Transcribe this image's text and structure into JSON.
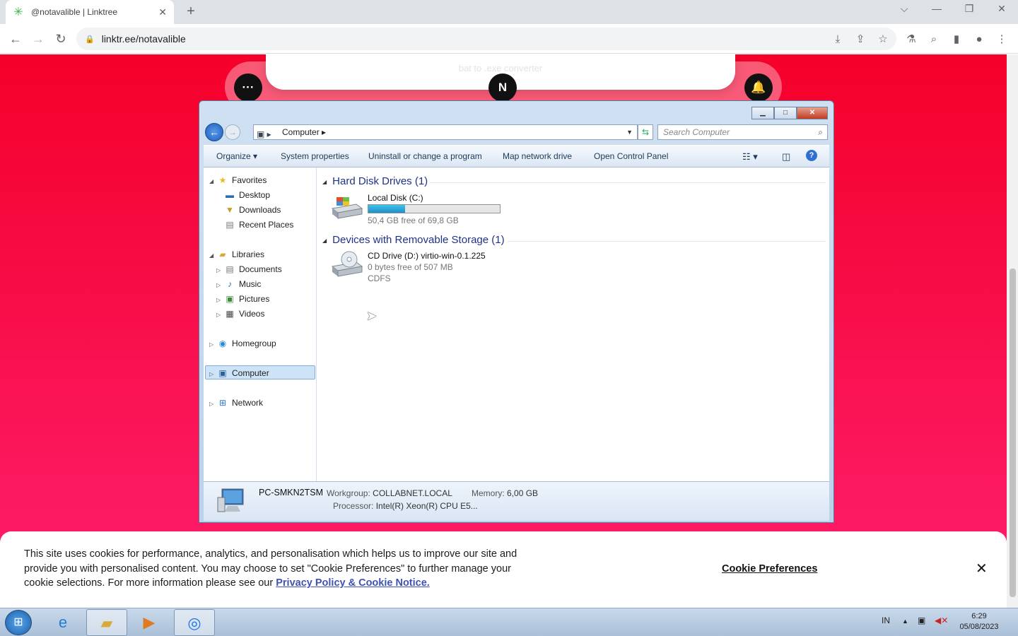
{
  "browser": {
    "tab_title": "@notavalible | Linktree",
    "url": "linktr.ee/notavalible",
    "tab_close": "✕",
    "new_tab": "+"
  },
  "linktree": {
    "search_text": "bat to .exe converter",
    "menu_label": "···",
    "avatar_letter": "N"
  },
  "explorer": {
    "breadcrumb": "Computer",
    "search_placeholder": "Search Computer",
    "commands": [
      "Organize",
      "System properties",
      "Uninstall or change a program",
      "Map network drive",
      "Open Control Panel"
    ],
    "nav": {
      "favorites": "Favorites",
      "desktop": "Desktop",
      "downloads": "Downloads",
      "recent": "Recent Places",
      "libraries": "Libraries",
      "documents": "Documents",
      "music": "Music",
      "pictures": "Pictures",
      "videos": "Videos",
      "homegroup": "Homegroup",
      "computer": "Computer",
      "network": "Network"
    },
    "groups": {
      "hdd": "Hard Disk Drives (1)",
      "removable": "Devices with Removable Storage (1)"
    },
    "drives": {
      "c_name": "Local Disk (C:)",
      "c_free": "50,4 GB free of 69,8 GB",
      "c_used_fraction": 0.28,
      "d_name": "CD Drive (D:) virtio-win-0.1.225",
      "d_free": "0 bytes free of 507 MB",
      "d_fs": "CDFS"
    },
    "details": {
      "pc_name": "PC-SMKN2TSM",
      "workgroup_label": "Workgroup:",
      "workgroup": "COLLABNET.LOCAL",
      "memory_label": "Memory:",
      "memory": "6,00 GB",
      "processor_label": "Processor:",
      "processor": "Intel(R) Xeon(R) CPU E5..."
    }
  },
  "cookie": {
    "text": "This site uses cookies for performance, analytics, and personalisation which helps us to improve our site and provide you with personalised content. You may choose to set \"Cookie Preferences\" to further manage your cookie selections. For more information please see our",
    "link": "Privacy Policy & Cookie Notice.",
    "preferences": "Cookie Preferences",
    "close": "✕"
  },
  "taskbar": {
    "language": "IN",
    "time": "6:29",
    "date": "05/08/2023"
  }
}
